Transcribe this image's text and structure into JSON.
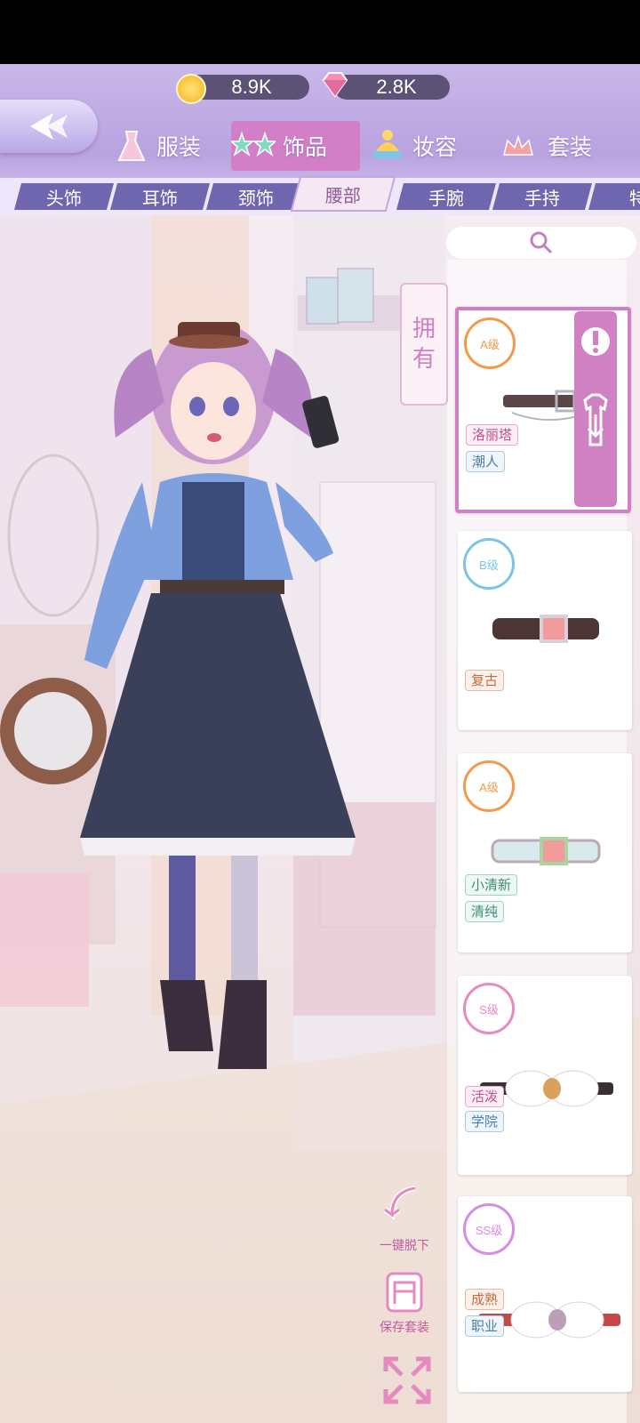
{
  "currency": {
    "gold": "8.9K",
    "diamond": "2.8K"
  },
  "categories": [
    {
      "label": "服装",
      "icon": "dress-icon"
    },
    {
      "label": "饰品",
      "icon": "stars-glasses-icon",
      "active": true
    },
    {
      "label": "妆容",
      "icon": "beanie-hat-icon"
    },
    {
      "label": "套装",
      "icon": "crown-icon"
    }
  ],
  "subtabs": [
    "头饰",
    "耳饰",
    "颈饰",
    "腰部",
    "手腕",
    "手持",
    "特"
  ],
  "active_subtab": "腰部",
  "owned_label": [
    "拥",
    "有"
  ],
  "items": [
    {
      "grade": "A级",
      "grade_color": "#f29a4a",
      "tags": [
        {
          "text": "洛丽塔",
          "style": "pink"
        },
        {
          "text": "潮人",
          "style": "blue"
        }
      ],
      "selected": true
    },
    {
      "grade": "B级",
      "grade_color": "#7dc3e8",
      "tags": [
        {
          "text": "复古",
          "style": "orange"
        }
      ]
    },
    {
      "grade": "A级",
      "grade_color": "#f29a4a",
      "tags": [
        {
          "text": "小清新",
          "style": "green"
        },
        {
          "text": "清纯",
          "style": "green"
        }
      ]
    },
    {
      "grade": "S级",
      "grade_color": "#e88ac0",
      "tags": [
        {
          "text": "活泼",
          "style": "pink"
        },
        {
          "text": "学院",
          "style": "blue"
        }
      ]
    },
    {
      "grade": "SS级",
      "grade_color": "#d78be3",
      "tags": [
        {
          "text": "成熟",
          "style": "orange"
        },
        {
          "text": "职业",
          "style": "blue"
        }
      ]
    }
  ],
  "actions": {
    "undress": "一键脱下",
    "save_outfit": "保存套装"
  }
}
